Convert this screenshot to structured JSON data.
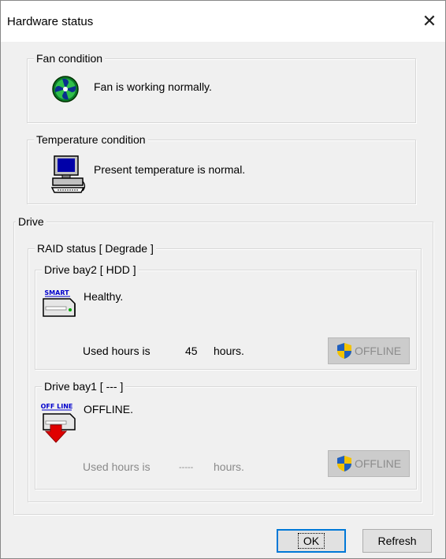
{
  "window": {
    "title": "Hardware status"
  },
  "fan": {
    "legend": "Fan condition",
    "status": "Fan is working normally."
  },
  "temperature": {
    "legend": "Temperature condition",
    "status": "Present temperature is normal."
  },
  "drive": {
    "legend": "Drive",
    "raid": {
      "legend": "RAID status [ Degrade ]",
      "bays": [
        {
          "legend": "Drive bay2 [ HDD ]",
          "status": "Healthy.",
          "icon_label": "SMART",
          "used_prefix": "Used hours is",
          "used_value": "45",
          "used_suffix": "hours.",
          "offline_label": "OFFLINE"
        },
        {
          "legend": "Drive bay1 [ --- ]",
          "status": "OFFLINE.",
          "icon_label": "OFF LINE",
          "used_prefix": "Used hours is",
          "used_value": "-----",
          "used_suffix": "hours.",
          "offline_label": "OFFLINE"
        }
      ]
    }
  },
  "buttons": {
    "ok": "OK",
    "refresh": "Refresh"
  },
  "colors": {
    "accent": "#0078d7",
    "error_red": "#e00000",
    "shield_blue": "#1f5fbf",
    "shield_yellow": "#f2c200"
  }
}
